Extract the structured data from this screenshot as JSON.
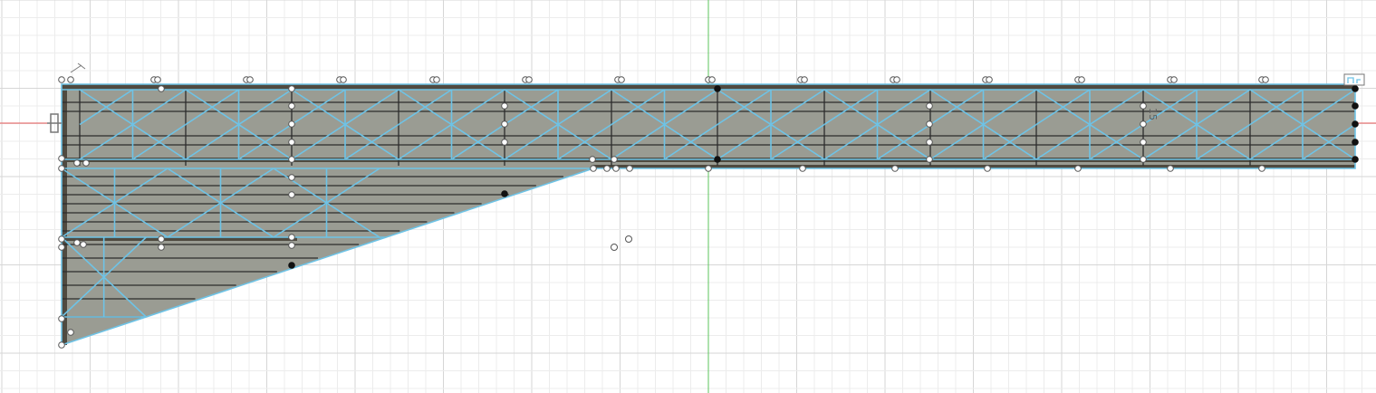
{
  "workspace": {
    "mode": "sketch",
    "constraint_label": "15"
  },
  "colors": {
    "background": "#ffffff",
    "grid_minor": "#ececec",
    "grid_major": "#d6d6d6",
    "x_axis": "#e25555",
    "y_axis": "#5cc45c",
    "face_fill": "#9a9c93",
    "sketch_line": "#6ec3e6",
    "edge_line": "#2c2c2c"
  },
  "icons": [
    "sketch-origin-icon",
    "horizontal-constraint-icon",
    "fix-constraint-icon",
    "coincident-constraint-icon"
  ]
}
